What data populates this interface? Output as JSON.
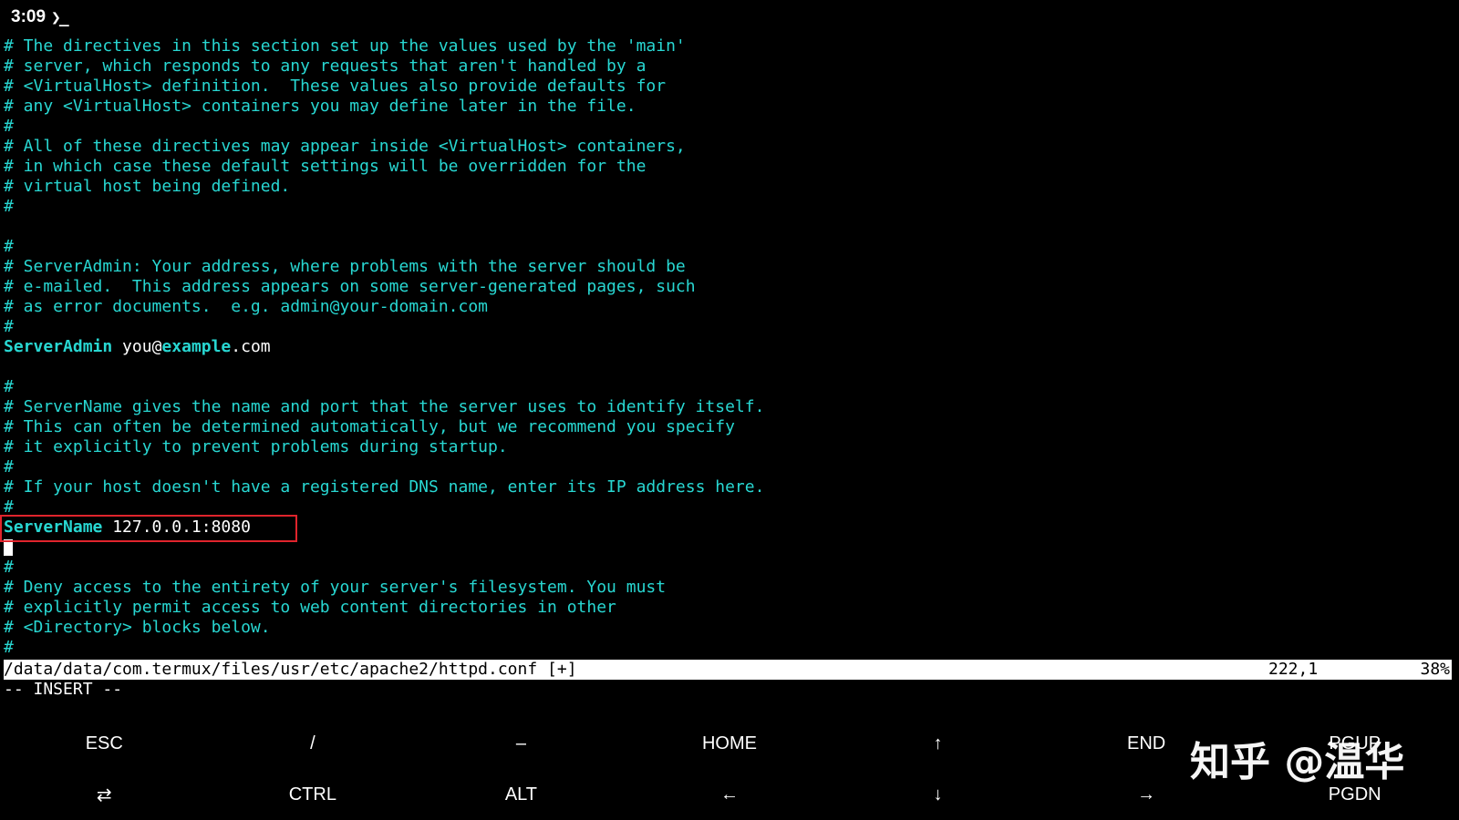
{
  "status_bar": {
    "time": "3:09",
    "terminal_icon": "terminal-prompt-icon"
  },
  "editor": {
    "lines": [
      "# The directives in this section set up the values used by the 'main'",
      "# server, which responds to any requests that aren't handled by a",
      "# <VirtualHost> definition.  These values also provide defaults for",
      "# any <VirtualHost> containers you may define later in the file.",
      "#",
      "# All of these directives may appear inside <VirtualHost> containers,",
      "# in which case these default settings will be overridden for the",
      "# virtual host being defined.",
      "#",
      "",
      "#",
      "# ServerAdmin: Your address, where problems with the server should be",
      "# e-mailed.  This address appears on some server-generated pages, such",
      "# as error documents.  e.g. admin@your-domain.com",
      "#"
    ],
    "server_admin": {
      "directive": "ServerAdmin",
      "value_user": " you@",
      "value_domain": "example",
      "value_tld": ".com"
    },
    "lines_2": [
      "",
      "#",
      "# ServerName gives the name and port that the server uses to identify itself.",
      "# This can often be determined automatically, but we recommend you specify",
      "# it explicitly to prevent problems during startup.",
      "#",
      "# If your host doesn't have a registered DNS name, enter its IP address here.",
      "#"
    ],
    "server_name": {
      "directive": "ServerName",
      "value": " 127.0.0.1:8080"
    },
    "lines_3": [
      "#",
      "# Deny access to the entirety of your server's filesystem. You must",
      "# explicitly permit access to web content directories in other",
      "# <Directory> blocks below.",
      "#"
    ]
  },
  "vim_status": {
    "file_path": "/data/data/com.termux/files/usr/etc/apache2/httpd.conf [+]",
    "position": "222,1",
    "percent": "38%",
    "mode": "-- INSERT --"
  },
  "extra_keys": {
    "row1": [
      "ESC",
      "/",
      "–",
      "HOME",
      "↑",
      "END",
      "PGUP"
    ],
    "row2": [
      "⇄",
      "CTRL",
      "ALT",
      "←",
      "↓",
      "→",
      "PGDN"
    ]
  },
  "watermark": "知乎 @温华",
  "colors": {
    "background": "#000000",
    "comment": "#28d7d2",
    "plain_text": "#ffffff",
    "highlight_border": "#e0242c",
    "status_line_bg": "#ffffff"
  }
}
